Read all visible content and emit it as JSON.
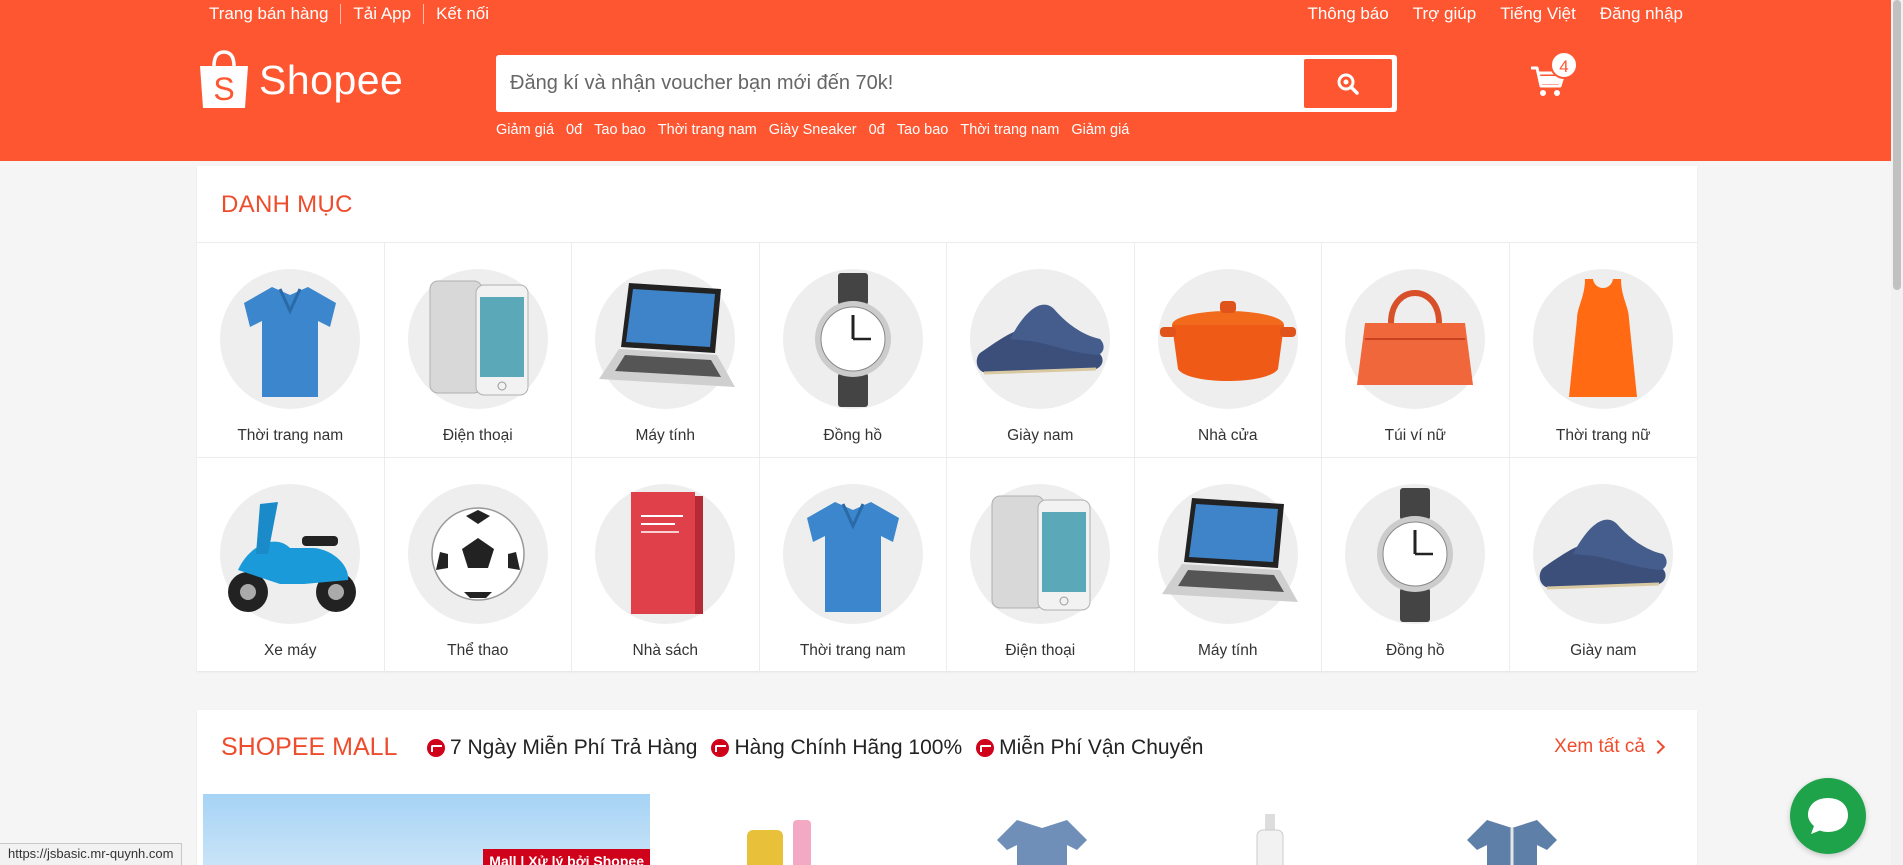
{
  "colors": {
    "brand": "#fe5631",
    "title": "#ee4d2d",
    "chat": "#1fa34a"
  },
  "topnav": {
    "left": [
      "Trang bán hàng",
      "Tải App",
      "Kết nối"
    ],
    "right": [
      "Thông báo",
      "Trợ giúp",
      "Tiếng Việt",
      "Đăng nhập"
    ]
  },
  "header": {
    "logo_text": "Shopee",
    "search_placeholder": "Đăng kí và nhận voucher bạn mới đến 70k!",
    "keywords": [
      "Giảm giá",
      "0đ",
      "Tao bao",
      "Thời trang nam",
      "Giày Sneaker",
      "0đ",
      "Tao bao",
      "Thời trang nam",
      "Giảm giá"
    ],
    "cart_count": "4"
  },
  "category": {
    "title": "DANH MỤC",
    "items": [
      {
        "label": "Thời trang nam",
        "icon": "shirt-icon"
      },
      {
        "label": "Điện thoại",
        "icon": "phone-icon"
      },
      {
        "label": "Máy tính",
        "icon": "laptop-icon"
      },
      {
        "label": "Đồng hồ",
        "icon": "watch-icon"
      },
      {
        "label": "Giày nam",
        "icon": "shoe-icon"
      },
      {
        "label": "Nhà cửa",
        "icon": "pot-icon"
      },
      {
        "label": "Túi ví nữ",
        "icon": "handbag-icon"
      },
      {
        "label": "Thời trang nữ",
        "icon": "dress-icon"
      },
      {
        "label": "Xe máy",
        "icon": "scooter-icon"
      },
      {
        "label": "Thể thao",
        "icon": "football-icon"
      },
      {
        "label": "Nhà sách",
        "icon": "book-icon"
      },
      {
        "label": "Thời trang nam",
        "icon": "shirt-icon"
      },
      {
        "label": "Điện thoại",
        "icon": "phone-icon"
      },
      {
        "label": "Máy tính",
        "icon": "laptop-icon"
      },
      {
        "label": "Đồng hồ",
        "icon": "watch-icon"
      },
      {
        "label": "Giày nam",
        "icon": "shoe-icon"
      }
    ]
  },
  "mall": {
    "title": "SHOPEE MALL",
    "badges": [
      "7 Ngày Miễn Phí Trả Hàng",
      "Hàng Chính Hãng 100%",
      "Miễn Phí Vận Chuyển"
    ],
    "see_all": "Xem tất cả",
    "banner_tag": "Mall | Xử lý bởi Shopee"
  },
  "statusbar": {
    "url": "https://jsbasic.mr-quynh.com"
  }
}
